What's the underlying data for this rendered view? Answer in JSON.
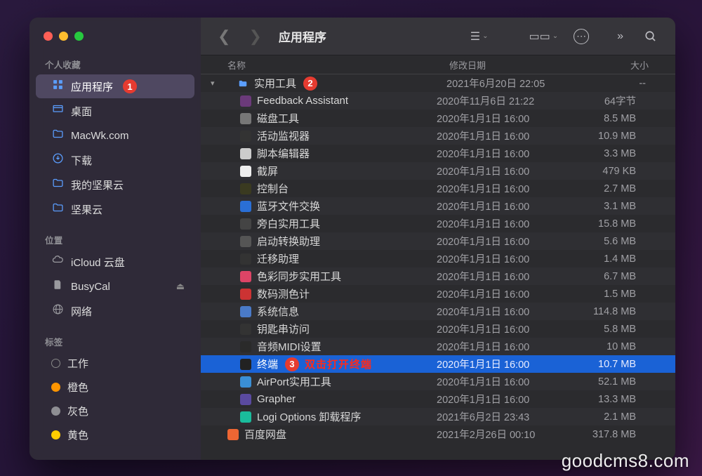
{
  "window": {
    "title": "应用程序"
  },
  "sidebar": {
    "sections": {
      "favorites": "个人收藏",
      "locations": "位置",
      "tags": "标签"
    },
    "favorites": [
      {
        "label": "应用程序",
        "icon": "apps",
        "selected": true,
        "badge": "1"
      },
      {
        "label": "桌面",
        "icon": "desktop"
      },
      {
        "label": "MacWk.com",
        "icon": "folder"
      },
      {
        "label": "下载",
        "icon": "download"
      },
      {
        "label": "我的坚果云",
        "icon": "folder"
      },
      {
        "label": "坚果云",
        "icon": "folder"
      }
    ],
    "locations": [
      {
        "label": "iCloud 云盘",
        "icon": "cloud"
      },
      {
        "label": "BusyCal",
        "icon": "disk",
        "eject": true
      },
      {
        "label": "网络",
        "icon": "globe"
      }
    ],
    "tags": [
      {
        "label": "工作",
        "color": "none"
      },
      {
        "label": "橙色",
        "color": "orange"
      },
      {
        "label": "灰色",
        "color": "gray"
      },
      {
        "label": "黄色",
        "color": "yellow"
      }
    ]
  },
  "columns": {
    "name": "名称",
    "date": "修改日期",
    "size": "大小"
  },
  "folder": {
    "name": "实用工具",
    "badge": "2",
    "date": "2021年6月20日 22:05",
    "size": "--"
  },
  "items": [
    {
      "name": "Feedback Assistant",
      "date": "2020年11月6日 21:22",
      "size": "64字节",
      "color": "#6b3a7a"
    },
    {
      "name": "磁盘工具",
      "date": "2020年1月1日 16:00",
      "size": "8.5 MB",
      "color": "#777"
    },
    {
      "name": "活动监视器",
      "date": "2020年1月1日 16:00",
      "size": "10.9 MB",
      "color": "#333"
    },
    {
      "name": "脚本编辑器",
      "date": "2020年1月1日 16:00",
      "size": "3.3 MB",
      "color": "#ccc"
    },
    {
      "name": "截屏",
      "date": "2020年1月1日 16:00",
      "size": "479 KB",
      "color": "#eee"
    },
    {
      "name": "控制台",
      "date": "2020年1月1日 16:00",
      "size": "2.7 MB",
      "color": "#3a3a20"
    },
    {
      "name": "蓝牙文件交换",
      "date": "2020年1月1日 16:00",
      "size": "3.1 MB",
      "color": "#2a6fd6"
    },
    {
      "name": "旁白实用工具",
      "date": "2020年1月1日 16:00",
      "size": "15.8 MB",
      "color": "#444"
    },
    {
      "name": "启动转换助理",
      "date": "2020年1月1日 16:00",
      "size": "5.6 MB",
      "color": "#555"
    },
    {
      "name": "迁移助理",
      "date": "2020年1月1日 16:00",
      "size": "1.4 MB",
      "color": "#333"
    },
    {
      "name": "色彩同步实用工具",
      "date": "2020年1月1日 16:00",
      "size": "6.7 MB",
      "color": "#d46"
    },
    {
      "name": "数码测色计",
      "date": "2020年1月1日 16:00",
      "size": "1.5 MB",
      "color": "#c33"
    },
    {
      "name": "系统信息",
      "date": "2020年1月1日 16:00",
      "size": "114.8 MB",
      "color": "#4a7ac8"
    },
    {
      "name": "钥匙串访问",
      "date": "2020年1月1日 16:00",
      "size": "5.8 MB",
      "color": "#333"
    },
    {
      "name": "音频MIDI设置",
      "date": "2020年1月1日 16:00",
      "size": "10 MB",
      "color": "#2a2a2a"
    },
    {
      "name": "终端",
      "date": "2020年1月1日 16:00",
      "size": "10.7 MB",
      "color": "#222",
      "selected": true,
      "badge": "3",
      "annotation": "双击打开终端"
    },
    {
      "name": "AirPort实用工具",
      "date": "2020年1月1日 16:00",
      "size": "52.1 MB",
      "color": "#3a8fd6"
    },
    {
      "name": "Grapher",
      "date": "2020年1月1日 16:00",
      "size": "13.3 MB",
      "color": "#5a4aa0"
    },
    {
      "name": "Logi Options 卸载程序",
      "date": "2021年6月2日 23:43",
      "size": "2.1 MB",
      "color": "#1abc9c"
    }
  ],
  "bottom_item": {
    "name": "百度网盘",
    "date": "2021年2月26日 00:10",
    "size": "317.8 MB",
    "color": "#e63"
  },
  "watermark": "goodcms8.com"
}
